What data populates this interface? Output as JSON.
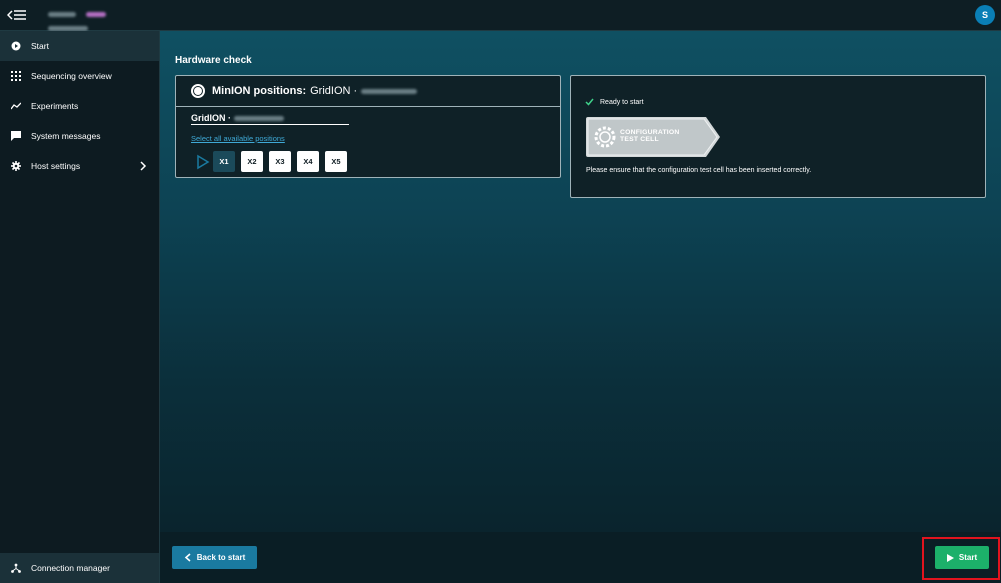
{
  "topbar": {
    "menu_icon": "menu-collapse-icon",
    "avatar_initial": "S"
  },
  "sidebar": {
    "items": [
      {
        "label": "Start",
        "icon": "play-circle-icon",
        "active": true
      },
      {
        "label": "Sequencing overview",
        "icon": "grid-icon",
        "active": false
      },
      {
        "label": "Experiments",
        "icon": "trend-line-icon",
        "active": false
      },
      {
        "label": "System messages",
        "icon": "message-icon",
        "active": false
      },
      {
        "label": "Host settings",
        "icon": "gear-icon",
        "active": false,
        "has_chevron": true
      }
    ],
    "connection_manager": {
      "label": "Connection manager",
      "icon": "network-icon"
    }
  },
  "main": {
    "title": "Hardware check",
    "positions_card": {
      "heading_bold": "MinION positions:",
      "heading_device": "GridION ·",
      "device_label": "GridION ·",
      "select_all_link": "Select all available positions",
      "positions": [
        {
          "label": "X1",
          "selected": true
        },
        {
          "label": "X2",
          "selected": false
        },
        {
          "label": "X3",
          "selected": false
        },
        {
          "label": "X4",
          "selected": false
        },
        {
          "label": "X5",
          "selected": false
        }
      ]
    },
    "status_card": {
      "ready_text": "Ready to start",
      "test_cell_line1": "CONFIGURATION",
      "test_cell_line2": "TEST CELL",
      "message": "Please ensure that the configuration test cell has been inserted correctly."
    }
  },
  "footer": {
    "back_label": "Back to start",
    "start_label": "Start"
  },
  "colors": {
    "accent_blue": "#1a7aa0",
    "start_green": "#1cb06a",
    "link": "#3fa9d6",
    "highlight": "#e0141e"
  }
}
